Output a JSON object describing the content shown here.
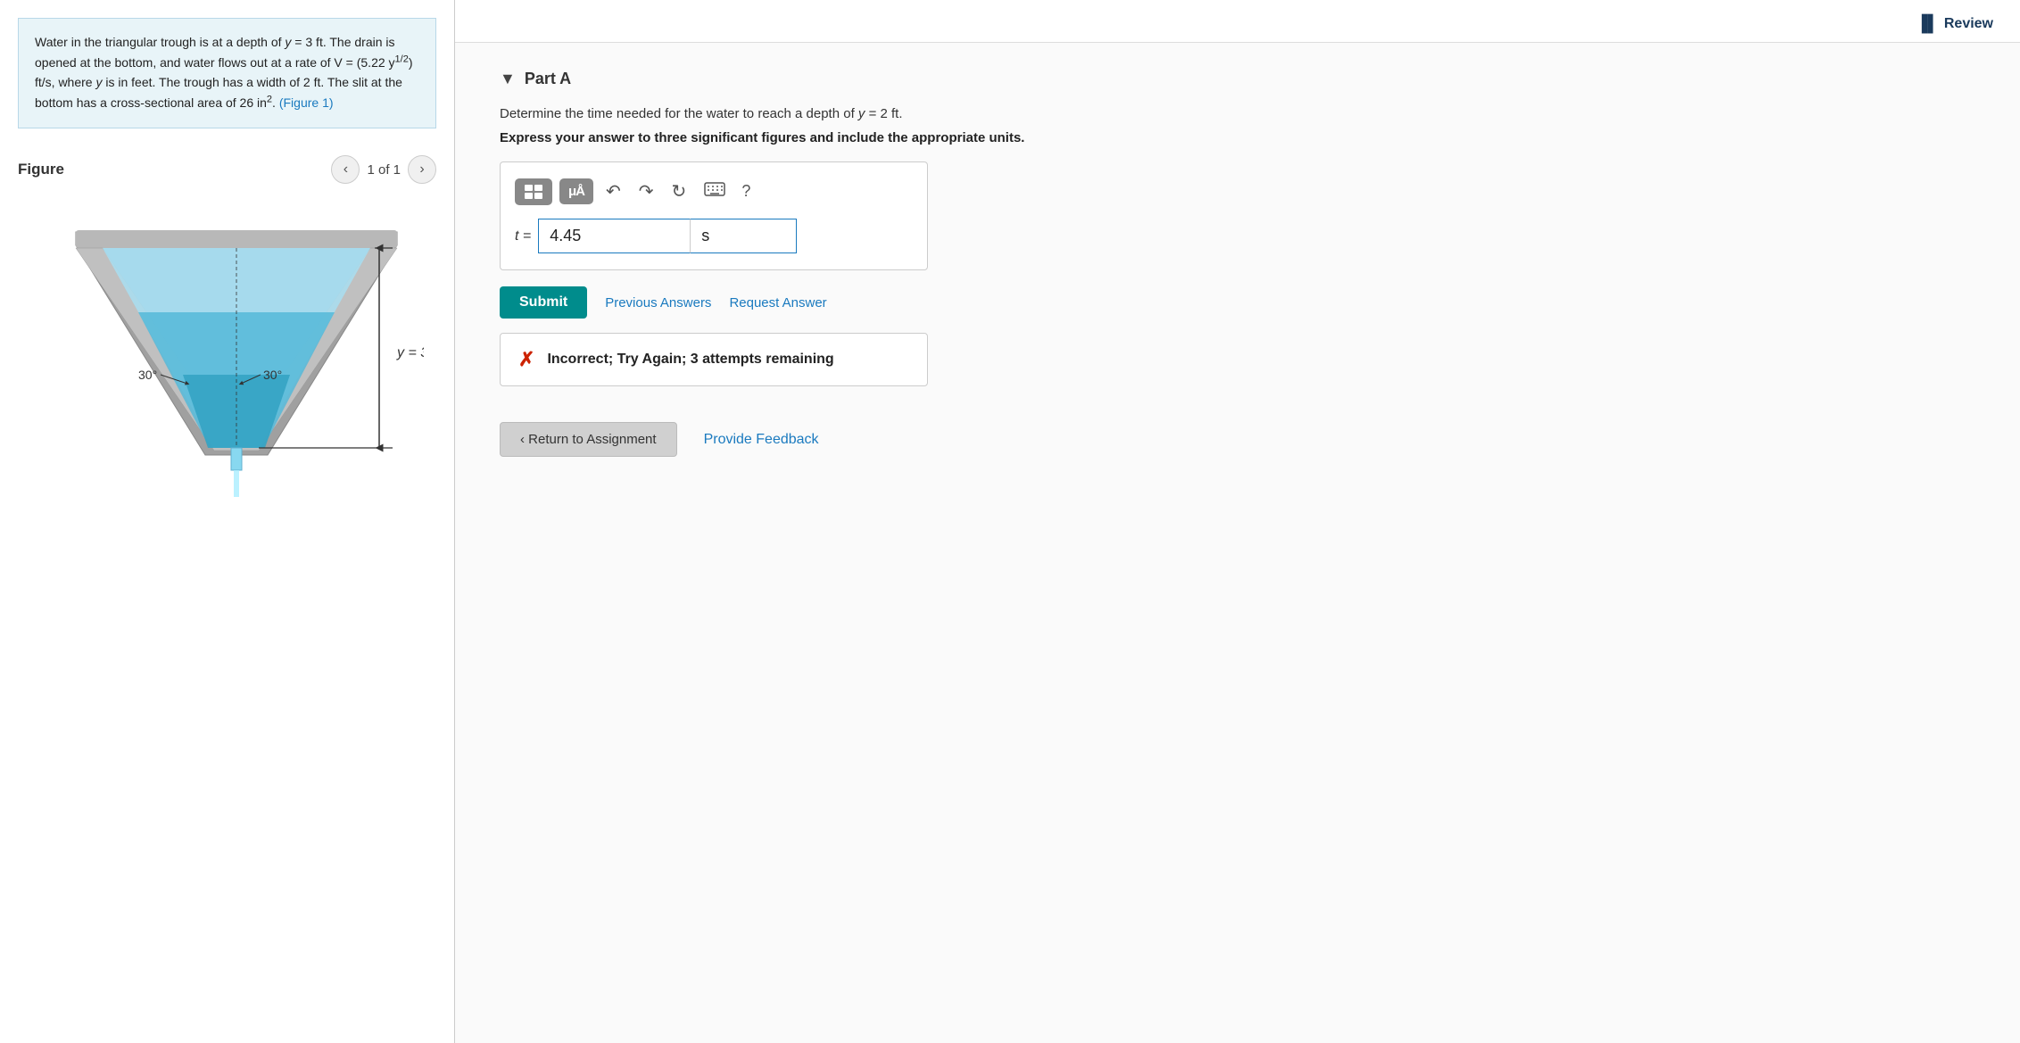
{
  "left": {
    "problem_text_parts": [
      "Water in the triangular trough is at a depth of y = 3 ft.",
      "The drain is opened at the bottom, and water flows out at a rate of V = (5.22 y",
      "1/2",
      ") ft/s, where y is in feet. The trough has a width of 2 ft. The slit at the bottom has a cross-sectional area of 26 in",
      "2",
      ". (Figure 1)"
    ],
    "figure_title": "Figure",
    "figure_counter": "1 of 1",
    "figure_link_text": "(Figure 1)"
  },
  "right": {
    "review_label": "Review",
    "part_title": "Part A",
    "question_text": "Determine the time needed for the water to reach a depth of y = 2 ft.",
    "question_instruction": "Express your answer to three significant figures and include the appropriate units.",
    "toolbar": {
      "grid_btn_title": "Grid/Matrix",
      "mu_btn_title": "μÅ",
      "undo_title": "Undo",
      "redo_title": "Redo",
      "reset_title": "Reset",
      "keyboard_title": "Keyboard",
      "help_title": "Help ?"
    },
    "input": {
      "label": "t =",
      "value": "4.45",
      "unit_value": "s"
    },
    "submit_label": "Submit",
    "prev_answers_label": "Previous Answers",
    "request_answer_label": "Request Answer",
    "incorrect_message": "Incorrect; Try Again; 3 attempts remaining",
    "return_btn_label": "‹ Return to Assignment",
    "provide_feedback_label": "Provide Feedback"
  }
}
